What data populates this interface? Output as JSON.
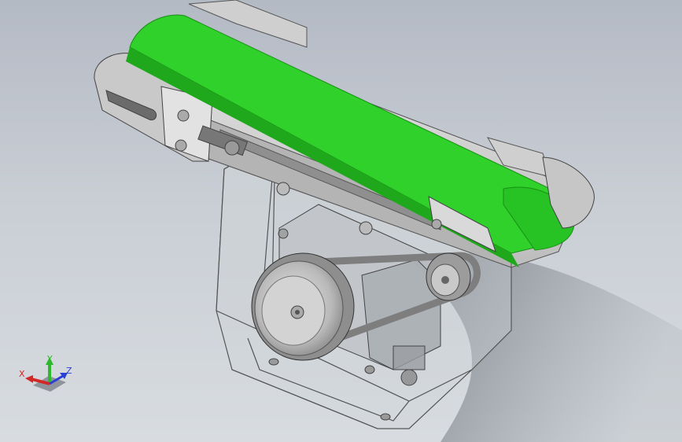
{
  "viewport": {
    "model": "belt-conveyor-assembly",
    "colors": {
      "background_top": "#b4bac4",
      "background_bottom": "#d8dce0",
      "belt": "#2fd12a",
      "belt_dark": "#1fa81c",
      "frame": "#d7d7d7",
      "frame_dark": "#9b9b9b",
      "housing_edge": "#555555",
      "pulley": "#c4c4c4"
    }
  },
  "triad": {
    "x_label": "X",
    "y_label": "Y",
    "z_label": "Z",
    "x_color": "#d32626",
    "y_color": "#2eb82e",
    "z_color": "#2a3fd6"
  }
}
